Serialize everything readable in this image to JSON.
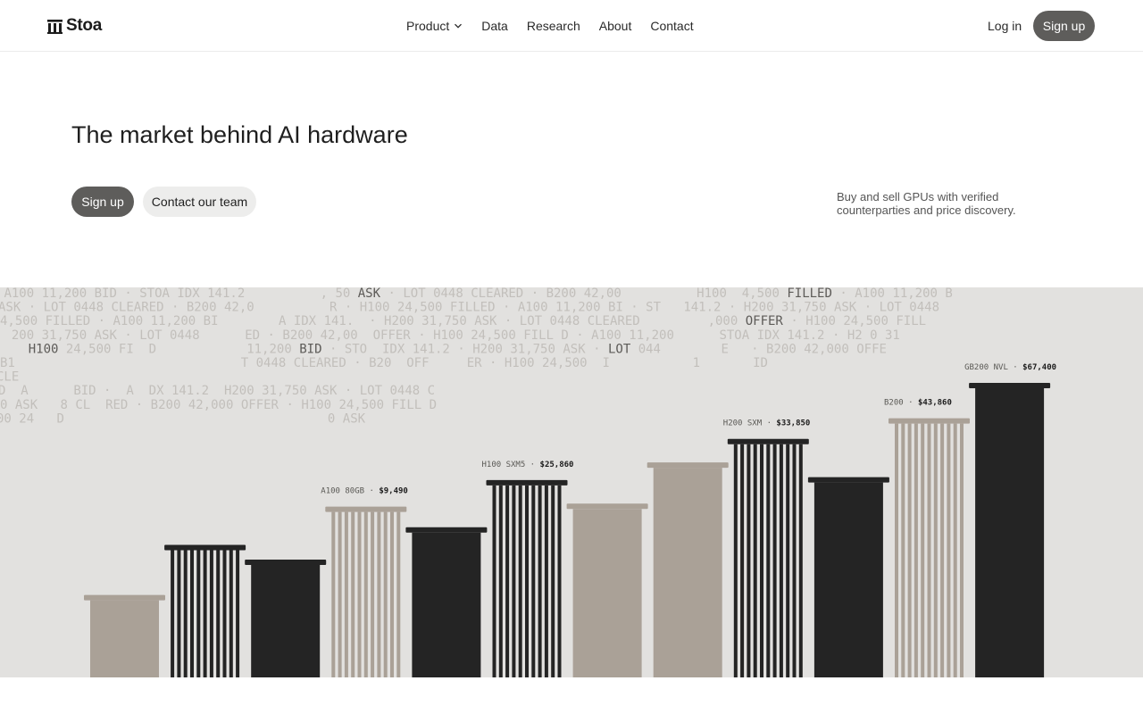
{
  "brand": {
    "name": "Stoa"
  },
  "nav": {
    "links": [
      {
        "label": "Product",
        "has_dropdown": true
      },
      {
        "label": "Data"
      },
      {
        "label": "Research"
      },
      {
        "label": "About"
      },
      {
        "label": "Contact"
      }
    ],
    "login_label": "Log in",
    "signup_label": "Sign up"
  },
  "hero": {
    "title": "The market behind AI hardware",
    "primary_cta": "Sign up",
    "secondary_cta": "Contact our team",
    "description": "Buy and sell GPUs with verified counterparties and price discovery."
  },
  "ticker": {
    "lines": [
      " A100 11,200 BID · STOA IDX 141.2          , 50 ASK · LOT 0448 CLEARED · B200 42,00          H100  4,500 FILLED · A100 11,200 B",
      "ASK · LOT 0448 CLEARED · B200 42,0          R · H100 24,500 FILLED · A100 11,200 BI · ST   141.2 · H200 31,750 ASK · LOT 0448",
      "4,500 FILLED · A100 11,200 BI        A IDX 141.  · H200 31,750 ASK · LOT 0448 CLEARED         ,000 OFFER · H100 24,500 FILL",
      "  200 31,750 ASK · LOT 0448      ED · B200 42,00  OFFER · H100 24,500 FILL D · A100 11,200      STOA IDX 141.2 · H2 0 31",
      "    H100 24,500 FI  D            11,200 BID · STO  IDX 141.2 · H200 31,750 ASK · LOT 044        E   · B200 42,000 OFFE",
      "B1                              T 0448 CLEARED · B20  OFF     ER · H100 24,500  I           1       ID",
      "CLE",
      "D  A      BID ·  A  DX 141.2  H200 31,750 ASK · LOT 0448 C",
      "0 ASK   8 CL  RED · B200 42,000 OFFER · H100 24,500 FILL D",
      "00 24   D                                   0 ASK"
    ]
  },
  "market": {
    "colors": {
      "dark": "#242424",
      "taupe": "#aaa197",
      "panel": "#e2e1df"
    }
  },
  "chart_data": {
    "type": "bar",
    "title": "",
    "values_relative": [
      0.28,
      0.45,
      0.4,
      0.58,
      0.51,
      0.67,
      0.59,
      0.73,
      0.81,
      0.68,
      0.88,
      1.0
    ],
    "styles": [
      "solid-taupe",
      "striped-dark",
      "solid-dark",
      "striped-taupe",
      "solid-dark",
      "striped-dark",
      "solid-taupe",
      "solid-taupe",
      "striped-dark",
      "solid-dark",
      "striped-taupe",
      "solid-dark"
    ],
    "annotations": [
      {
        "bar_index": 3,
        "label": "A100 80GB",
        "price": "$9,490"
      },
      {
        "bar_index": 5,
        "label": "H100 SXM5",
        "price": "$25,860"
      },
      {
        "bar_index": 8,
        "label": "H200 SXM",
        "price": "$33,850"
      },
      {
        "bar_index": 10,
        "label": "B200",
        "price": "$43,860"
      },
      {
        "bar_index": 11,
        "label": "GB200 NVL",
        "price": "$67,400"
      }
    ]
  }
}
